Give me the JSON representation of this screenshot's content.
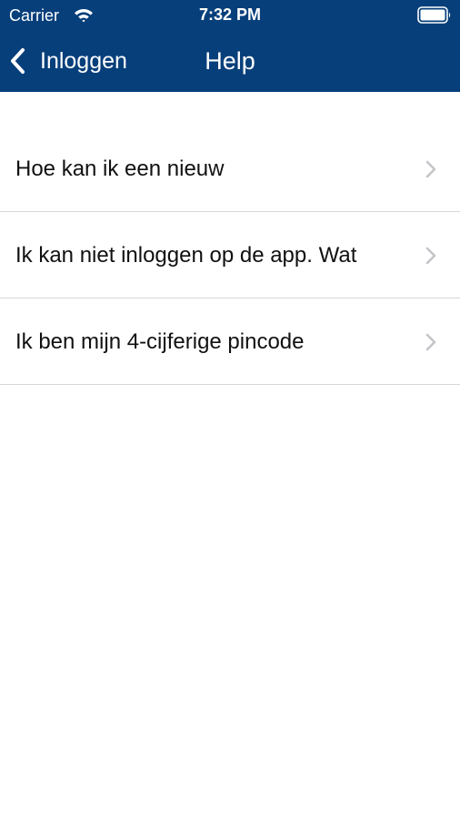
{
  "status_bar": {
    "carrier": "Carrier",
    "time": "7:32 PM",
    "wifi_icon": "wifi-icon",
    "battery_icon": "battery-icon"
  },
  "nav_bar": {
    "back_label": "Inloggen",
    "back_icon": "chevron-left-icon",
    "title": "Help"
  },
  "help_items": [
    {
      "label": "Hoe kan ik een nieuw"
    },
    {
      "label": "Ik kan niet inloggen op de app. Wat"
    },
    {
      "label": "Ik ben mijn 4-cijferige pincode"
    }
  ],
  "colors": {
    "nav_background": "#073f7b",
    "separator": "#d8d8d8",
    "chevron": "#c4c4c9",
    "text": "#111111"
  }
}
